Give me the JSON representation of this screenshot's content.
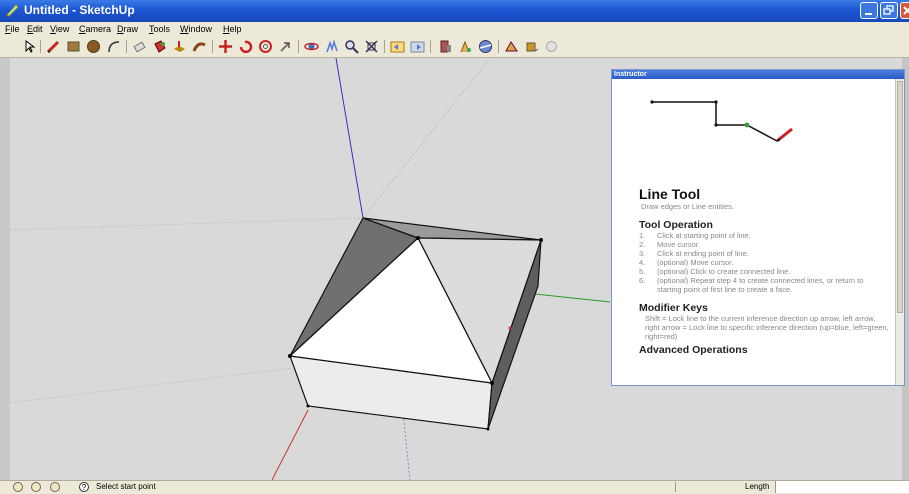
{
  "window": {
    "title": "Untitled - SketchUp"
  },
  "menu": [
    "File",
    "Edit",
    "View",
    "Camera",
    "Draw",
    "Tools",
    "Window",
    "Help"
  ],
  "toolbar": {
    "icons": [
      "select-icon",
      "pencil-line-icon",
      "rectangle-icon",
      "circle-icon",
      "arc-icon",
      "eraser-icon",
      "paint-bucket-icon",
      "push-pull-icon",
      "follow-me-icon",
      "move-icon",
      "rotate-icon",
      "offset-icon",
      "tape-measure-icon",
      "orbit-icon",
      "pan-icon",
      "zoom-icon",
      "zoom-extents-icon",
      "previous-view-icon",
      "next-view-icon",
      "components-icon",
      "materials-icon",
      "styles-icon",
      "scenes-icon",
      "shadows-icon",
      "fog-icon"
    ]
  },
  "instructor": {
    "title": "Instructor",
    "tool_title": "Line Tool",
    "tool_desc": "Draw edges or Line entities.",
    "operation_heading": "Tool Operation",
    "steps": [
      {
        "n": "1.",
        "text": "Click at starting point of line."
      },
      {
        "n": "2.",
        "text": "Move cursor."
      },
      {
        "n": "3.",
        "text": "Click at ending point of line."
      },
      {
        "n": "4.",
        "text": "(optional) Move cursor."
      },
      {
        "n": "5.",
        "text": "(optional) Click to create connected line."
      },
      {
        "n": "6.",
        "text": "(optional) Repeat step 4 to create connected lines, or return to starting point of first line to create a face."
      }
    ],
    "modifier_heading": "Modifier Keys",
    "modifier_text": "Shift = Lock line to the current inference direction up arrow, left arrow, right arrow = Lock line to specific inference direction (up=blue, left=green, right=red)",
    "cut_heading": "Advanced Operations"
  },
  "status": {
    "message": "Select start point",
    "length_label": "Length",
    "length_value": ""
  },
  "colors": {
    "axis_red": "#cc3333",
    "axis_green": "#2e9a2e",
    "axis_blue": "#3333cc",
    "titlebar": "#1c56d3"
  }
}
